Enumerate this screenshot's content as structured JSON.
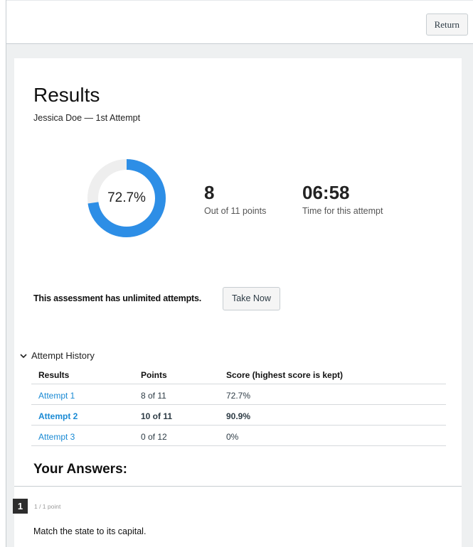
{
  "header": {
    "return_label": "Return"
  },
  "results": {
    "title": "Results",
    "subtitle": "Jessica Doe — 1st Attempt",
    "score_percent_text": "72.7%",
    "score_fraction": 0.727,
    "points": "8",
    "points_caption": "Out of 11 points",
    "time": "06:58",
    "time_caption": "Time for this attempt"
  },
  "attempts": {
    "notice": "This assessment has unlimited attempts.",
    "take_now_label": "Take Now"
  },
  "history": {
    "toggle_label": "Attempt History",
    "columns": [
      "Results",
      "Points",
      "Score (highest score is kept)"
    ],
    "rows": [
      {
        "name": "Attempt 1",
        "points": "8 of 11",
        "score": "72.7%"
      },
      {
        "name": "Attempt 2",
        "points": "10 of 11",
        "score": "90.9%"
      },
      {
        "name": "Attempt 3",
        "points": "0 of 12",
        "score": "0%"
      }
    ]
  },
  "answers": {
    "heading": "Your Answers:",
    "question_number": "1",
    "question_points": "1 / 1 point",
    "question_text": "Match the state to its capital."
  },
  "colors": {
    "accent": "#2d8ee6",
    "link": "#1a8ad4",
    "ring_track": "#eeeeee"
  }
}
